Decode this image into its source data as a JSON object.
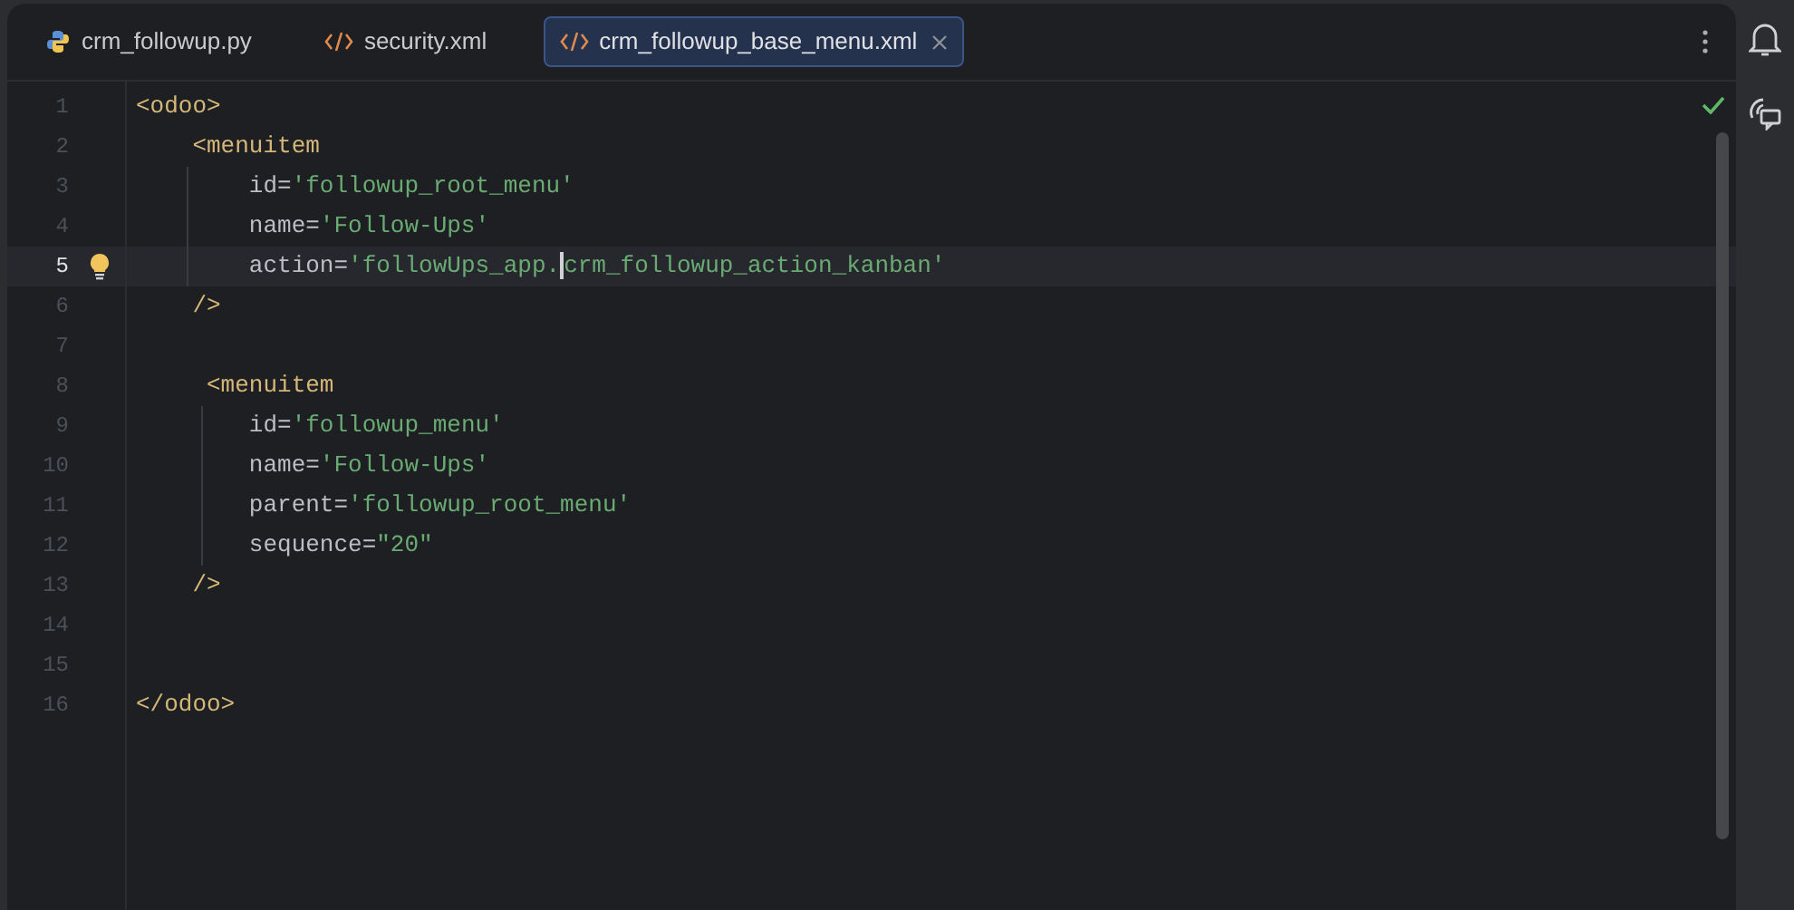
{
  "tabs": [
    {
      "label": "crm_followup.py",
      "kind": "python",
      "selected": false
    },
    {
      "label": "security.xml",
      "kind": "xml",
      "selected": false
    },
    {
      "label": "crm_followup_base_menu.xml",
      "kind": "xml",
      "selected": true
    }
  ],
  "editor": {
    "lines": [
      {
        "number": "1",
        "current": false,
        "tokens": [
          {
            "kind": "tag",
            "text": "<odoo>"
          }
        ]
      },
      {
        "number": "2",
        "current": false,
        "tokens": [
          {
            "kind": "tag",
            "text": "    <menuitem"
          }
        ]
      },
      {
        "number": "3",
        "current": false,
        "tokens": [
          {
            "kind": "attr",
            "text": "        id="
          },
          {
            "kind": "value",
            "text": "'followup_root_menu'"
          }
        ]
      },
      {
        "number": "4",
        "current": false,
        "tokens": [
          {
            "kind": "attr",
            "text": "        name="
          },
          {
            "kind": "value",
            "text": "'Follow-Ups'"
          }
        ]
      },
      {
        "number": "5",
        "current": true,
        "tokens": [
          {
            "kind": "attr",
            "text": "        action="
          },
          {
            "kind": "value",
            "text": "'followUps_app."
          },
          {
            "kind": "value",
            "text": "crm_followup_action_kanban'",
            "caret": true
          }
        ]
      },
      {
        "number": "6",
        "current": false,
        "tokens": [
          {
            "kind": "tag",
            "text": "    />"
          }
        ]
      },
      {
        "number": "7",
        "current": false
      },
      {
        "number": "8",
        "current": false,
        "tokens": [
          {
            "kind": "tag",
            "text": "     <menuitem"
          }
        ]
      },
      {
        "number": "9",
        "current": false,
        "tokens": [
          {
            "kind": "attr",
            "text": "        id="
          },
          {
            "kind": "value",
            "text": "'followup_menu'"
          }
        ]
      },
      {
        "number": "10",
        "current": false,
        "tokens": [
          {
            "kind": "attr",
            "text": "        name="
          },
          {
            "kind": "value",
            "text": "'Follow-Ups'"
          }
        ]
      },
      {
        "number": "11",
        "current": false,
        "tokens": [
          {
            "kind": "attr",
            "text": "        parent="
          },
          {
            "kind": "value",
            "text": "'followup_root_menu'"
          }
        ]
      },
      {
        "number": "12",
        "current": false,
        "tokens": [
          {
            "kind": "attr",
            "text": "        sequence="
          },
          {
            "kind": "value",
            "text": "\"20\""
          }
        ]
      },
      {
        "number": "13",
        "current": false,
        "tokens": [
          {
            "kind": "tag",
            "text": "    />"
          }
        ]
      },
      {
        "number": "14",
        "current": false
      },
      {
        "number": "15",
        "current": false
      },
      {
        "number": "16",
        "current": false,
        "tokens": [
          {
            "kind": "tag",
            "text": "</odoo>"
          }
        ]
      }
    ]
  }
}
